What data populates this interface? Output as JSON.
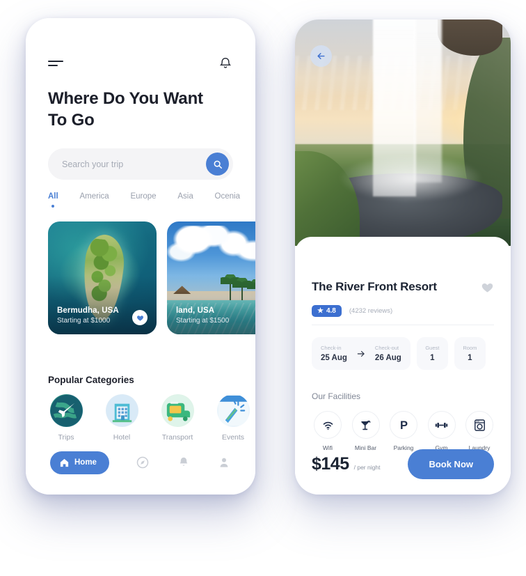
{
  "left_phone": {
    "topbar": {
      "menu_icon": "hamburger-menu-icon",
      "notification_icon": "bell-icon"
    },
    "heading": "Where Do You Want To Go",
    "search": {
      "placeholder": "Search your trip",
      "value": "",
      "button_icon": "search-icon"
    },
    "tabs": [
      {
        "label": "All",
        "active": true
      },
      {
        "label": "America",
        "active": false
      },
      {
        "label": "Europe",
        "active": false
      },
      {
        "label": "Asia",
        "active": false
      },
      {
        "label": "Ocenia",
        "active": false
      }
    ],
    "destination_cards": [
      {
        "title": "Bermudha, USA",
        "subtitle": "Starting at $1000",
        "favorite": true,
        "image": "aerial-island-turquoise-sea"
      },
      {
        "title": "land, USA",
        "subtitle": "Starting at $1500",
        "favorite": false,
        "image": "tropical-beach-palm-trees"
      }
    ],
    "categories_heading": "Popular Categories",
    "categories": [
      {
        "label": "Trips",
        "icon": "globe-airplane-icon"
      },
      {
        "label": "Hotel",
        "icon": "hotel-building-icon"
      },
      {
        "label": "Transport",
        "icon": "bus-icon"
      },
      {
        "label": "Events",
        "icon": "party-popper-icon"
      }
    ],
    "bottom_nav": [
      {
        "label": "Home",
        "icon": "home-icon",
        "active": true
      },
      {
        "label": "",
        "icon": "compass-icon",
        "active": false
      },
      {
        "label": "",
        "icon": "bell-icon",
        "active": false
      },
      {
        "label": "",
        "icon": "person-icon",
        "active": false
      }
    ]
  },
  "right_phone": {
    "hero": {
      "image": "waterfall-sunset-landscape",
      "back_icon": "arrow-left-icon"
    },
    "title": "The River Front Resort",
    "favorite_icon": "heart-icon",
    "rating": "4.8",
    "rating_star": "★",
    "reviews": "(4232 reviews)",
    "booking": {
      "checkin_label": "Check-in",
      "checkin_value": "25 Aug",
      "arrow_icon": "arrow-right-icon",
      "checkout_label": "Check-out",
      "checkout_value": "26 Aug",
      "guest_label": "Guest",
      "guest_value": "1",
      "room_label": "Room",
      "room_value": "1"
    },
    "facilities_heading": "Our Facilities",
    "facilities": [
      {
        "label": "Wifi",
        "icon": "wifi-icon"
      },
      {
        "label": "Mini Bar",
        "icon": "cocktail-icon"
      },
      {
        "label": "Parking",
        "icon": "parking-icon"
      },
      {
        "label": "Gym",
        "icon": "dumbbell-icon"
      },
      {
        "label": "Laundry",
        "icon": "washing-machine-icon"
      }
    ],
    "price": "$145",
    "per_night": "/ per night",
    "book_button": "Book Now"
  },
  "colors": {
    "accent_blue": "#4a7fd4",
    "badge_blue": "#3c6fd0",
    "text_dark": "#1c2433",
    "text_muted": "#9aa0ad",
    "surface": "#f7f8fb"
  }
}
